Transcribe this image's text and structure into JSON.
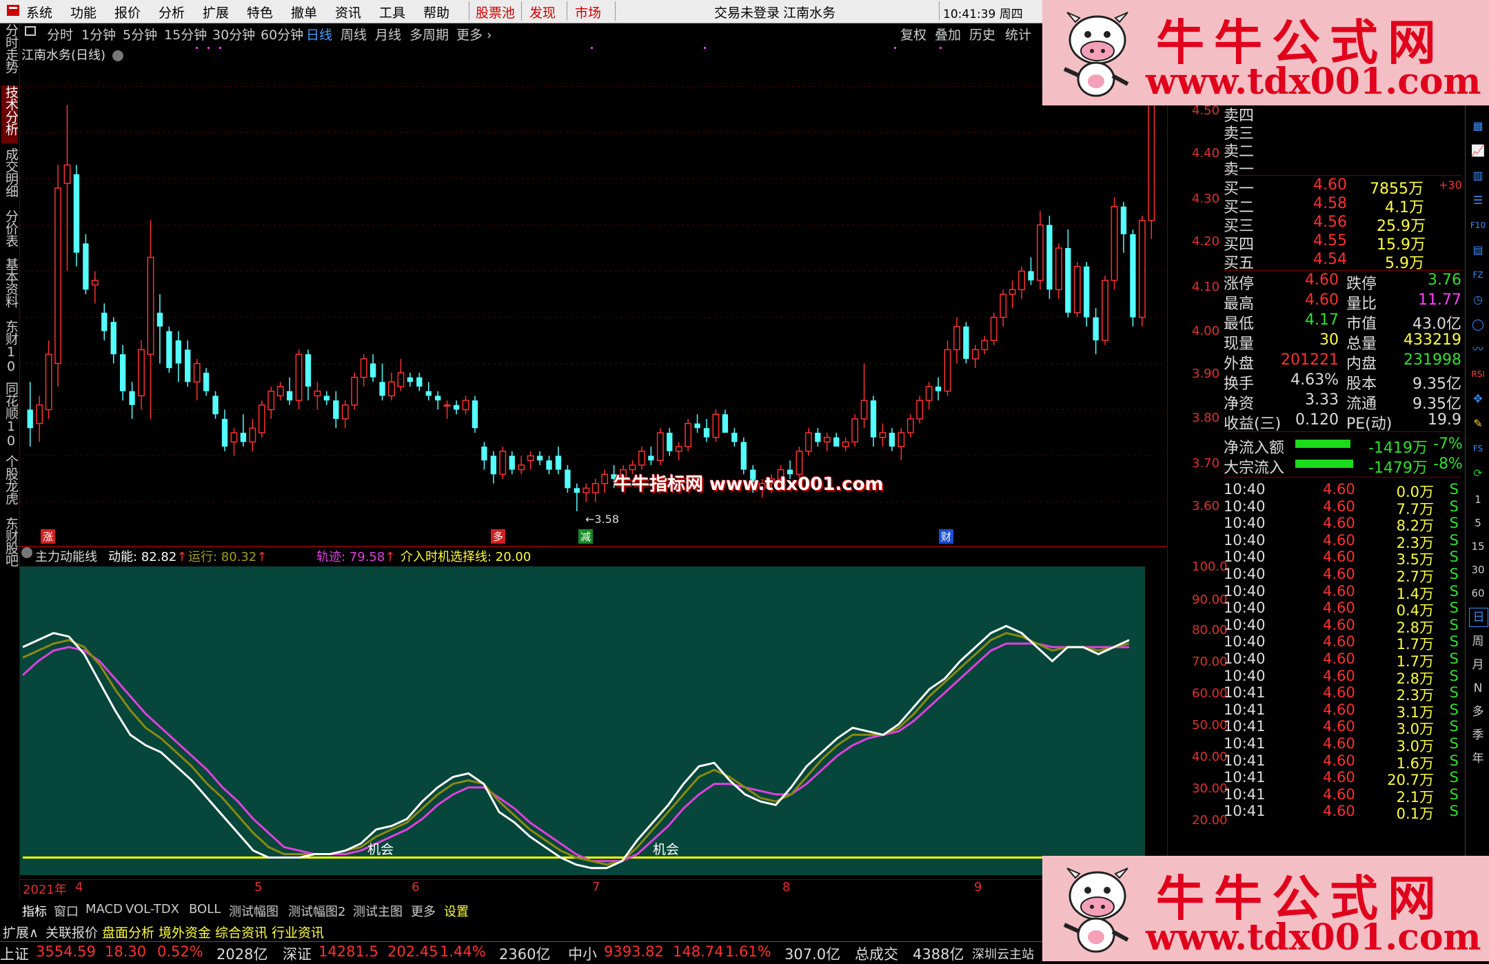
{
  "menu": {
    "items": [
      "系统",
      "功能",
      "报价",
      "分析",
      "扩展",
      "特色",
      "撤单",
      "资讯",
      "工具",
      "帮助"
    ],
    "red_items": [
      "股票池",
      "发现",
      "市场"
    ],
    "login_status": "交易未登录",
    "stock_title": "江南水务",
    "clock": "10:41:39 周四"
  },
  "periods": {
    "items": [
      "分时",
      "1分钟",
      "5分钟",
      "15分钟",
      "30分钟",
      "60分钟",
      "日线",
      "周线",
      "月线",
      "多周期",
      "更多"
    ],
    "active": "日线",
    "tools": [
      "复权",
      "叠加",
      "历史",
      "统计"
    ]
  },
  "left_tabs": [
    "分时走势",
    "技术分析",
    "成交明细",
    "分价表",
    "基本资料",
    "东财10",
    "同花顺10",
    "个股龙虎",
    "东财股吧"
  ],
  "left_tab_active": "技术分析",
  "main_chart": {
    "title": "江南水务(日线)",
    "low_marker": "3.58",
    "badges": [
      {
        "label": "涨",
        "color": "#d02020"
      },
      {
        "label": "多",
        "color": "#d02020"
      },
      {
        "label": "减",
        "color": "#1a8a2a"
      },
      {
        "label": "财",
        "color": "#1a4fd0"
      }
    ],
    "y_labels": [
      "4.50",
      "4.40",
      "4.30",
      "4.20",
      "4.10",
      "4.00",
      "3.90",
      "3.80",
      "3.70",
      "3.60"
    ]
  },
  "indicator": {
    "name": "主力动能线",
    "dongneng_label": "动能: 82.82",
    "yunxing_label": "运行: 80.32",
    "guiji_label": "轨迹: 79.58",
    "entry_label": "介入时机选择线: 20.00",
    "opportunity_label": "机会",
    "y_labels": [
      "100.0",
      "90.00",
      "80.00",
      "70.00",
      "60.00",
      "50.00",
      "40.00",
      "30.00",
      "20.00"
    ],
    "colors": {
      "dongneng": "#ffffff",
      "yunxing": "#8a8a10",
      "guiji": "#e040e0",
      "entry": "#ffff00",
      "background": "#07463a"
    }
  },
  "time_axis": [
    "2021年",
    "4",
    "5",
    "6",
    "7",
    "8",
    "9"
  ],
  "order_book": {
    "sell": [
      "卖四",
      "卖三",
      "卖二",
      "卖一"
    ],
    "buy": [
      {
        "label": "买一",
        "price": "4.60",
        "vol": "7855万",
        "extra": "+30"
      },
      {
        "label": "买二",
        "price": "4.58",
        "vol": "4.1万",
        "extra": ""
      },
      {
        "label": "买三",
        "price": "4.56",
        "vol": "25.9万",
        "extra": ""
      },
      {
        "label": "买四",
        "price": "4.55",
        "vol": "15.9万",
        "extra": ""
      },
      {
        "label": "买五",
        "price": "4.54",
        "vol": "5.9万",
        "extra": ""
      }
    ]
  },
  "quote": [
    {
      "l1": "涨停",
      "v1": "4.60",
      "c1": "#ff3030",
      "l2": "跌停",
      "v2": "3.76",
      "c2": "#30e030"
    },
    {
      "l1": "最高",
      "v1": "4.60",
      "c1": "#ff3030",
      "l2": "量比",
      "v2": "11.77",
      "c2": "#ff40ff"
    },
    {
      "l1": "最低",
      "v1": "4.17",
      "c1": "#30e030",
      "l2": "市值",
      "v2": "43.0亿",
      "c2": "#dddddd"
    },
    {
      "l1": "现量",
      "v1": "30",
      "c1": "#ffff40",
      "l2": "总量",
      "v2": "433219",
      "c2": "#ffff40"
    },
    {
      "l1": "外盘",
      "v1": "201221",
      "c1": "#ff3030",
      "l2": "内盘",
      "v2": "231998",
      "c2": "#30e030"
    },
    {
      "l1": "换手",
      "v1": "4.63%",
      "c1": "#dddddd",
      "l2": "股本",
      "v2": "9.35亿",
      "c2": "#dddddd"
    },
    {
      "l1": "净资",
      "v1": "3.33",
      "c1": "#dddddd",
      "l2": "流通",
      "v2": "9.35亿",
      "c2": "#dddddd"
    },
    {
      "l1": "收益(三)",
      "v1": "0.120",
      "c1": "#dddddd",
      "l2": "PE(动)",
      "v2": "19.9",
      "c2": "#dddddd"
    }
  ],
  "flows": [
    {
      "label": "净流入额",
      "value": "-1419万",
      "pct": "-7%"
    },
    {
      "label": "大宗流入",
      "value": "-1479万",
      "pct": "-8%"
    }
  ],
  "ticks": [
    {
      "t": "10:40",
      "p": "4.60",
      "v": "0.0万",
      "s": "S"
    },
    {
      "t": "10:40",
      "p": "4.60",
      "v": "7.7万",
      "s": "S"
    },
    {
      "t": "10:40",
      "p": "4.60",
      "v": "8.2万",
      "s": "S"
    },
    {
      "t": "10:40",
      "p": "4.60",
      "v": "2.3万",
      "s": "S"
    },
    {
      "t": "10:40",
      "p": "4.60",
      "v": "3.5万",
      "s": "S"
    },
    {
      "t": "10:40",
      "p": "4.60",
      "v": "2.7万",
      "s": "S"
    },
    {
      "t": "10:40",
      "p": "4.60",
      "v": "1.4万",
      "s": "S"
    },
    {
      "t": "10:40",
      "p": "4.60",
      "v": "0.4万",
      "s": "S"
    },
    {
      "t": "10:40",
      "p": "4.60",
      "v": "2.8万",
      "s": "S"
    },
    {
      "t": "10:40",
      "p": "4.60",
      "v": "1.7万",
      "s": "S"
    },
    {
      "t": "10:40",
      "p": "4.60",
      "v": "1.7万",
      "s": "S"
    },
    {
      "t": "10:40",
      "p": "4.60",
      "v": "2.8万",
      "s": "S"
    },
    {
      "t": "10:41",
      "p": "4.60",
      "v": "2.3万",
      "s": "S"
    },
    {
      "t": "10:41",
      "p": "4.60",
      "v": "3.1万",
      "s": "S"
    },
    {
      "t": "10:41",
      "p": "4.60",
      "v": "3.0万",
      "s": "S"
    },
    {
      "t": "10:41",
      "p": "4.60",
      "v": "3.0万",
      "s": "S"
    },
    {
      "t": "10:41",
      "p": "4.60",
      "v": "1.6万",
      "s": "S"
    },
    {
      "t": "10:41",
      "p": "4.60",
      "v": "20.7万",
      "s": "S"
    },
    {
      "t": "10:41",
      "p": "4.60",
      "v": "2.1万",
      "s": "S"
    },
    {
      "t": "10:41",
      "p": "4.60",
      "v": "0.1万",
      "s": "S"
    }
  ],
  "right_icons": [
    "1",
    "5",
    "15",
    "30",
    "60",
    "日",
    "周",
    "月",
    "N",
    "多",
    "季",
    "年"
  ],
  "indicator_tabs": [
    "指标",
    "窗口",
    "MACD",
    "VOL-TDX",
    "BOLL",
    "测试幅图",
    "测试幅图2",
    "测试主图",
    "更多",
    "设置"
  ],
  "function_tabs": [
    {
      "label": "扩展∧",
      "color": "#dddddd"
    },
    {
      "label": "关联报价",
      "color": "#dddddd"
    },
    {
      "label": "盘面分析",
      "color": "#ffff40"
    },
    {
      "label": "境外资金",
      "color": "#ffff40"
    },
    {
      "label": "综合资讯",
      "color": "#ffff40"
    },
    {
      "label": "行业资讯",
      "color": "#ffff40"
    }
  ],
  "status": [
    {
      "label": "上证",
      "v": "3554.59",
      "c": "18.30",
      "p": "0.52%",
      "amt": "2028亿"
    },
    {
      "label": "深证",
      "v": "14281.5",
      "c": "202.45",
      "p": "1.44%",
      "amt": "2360亿"
    },
    {
      "label": "中小",
      "v": "9393.82",
      "c": "148.74",
      "p": "1.61%",
      "amt": "307.0亿"
    }
  ],
  "status_total_label": "总成交",
  "status_total": "4388亿",
  "status_site": "深圳云主站",
  "ads": {
    "cn": "牛牛公式网",
    "url": "www.tdx001.com"
  },
  "watermark": "牛牛指标网 www.tdx001.com",
  "chart_data": {
    "type": "candlestick",
    "title": "江南水务(日线)",
    "ylim": [
      3.55,
      4.55
    ],
    "candles_ohlc": [
      [
        3.8,
        3.86,
        3.72,
        3.76
      ],
      [
        3.77,
        3.83,
        3.73,
        3.81
      ],
      [
        3.8,
        3.95,
        3.78,
        3.92
      ],
      [
        3.9,
        4.33,
        3.85,
        4.28
      ],
      [
        4.29,
        4.46,
        4.1,
        4.33
      ],
      [
        4.31,
        4.33,
        4.11,
        4.14
      ],
      [
        4.16,
        4.18,
        4.05,
        4.06
      ],
      [
        4.07,
        4.1,
        4.03,
        4.08
      ],
      [
        4.01,
        4.03,
        3.95,
        3.97
      ],
      [
        3.99,
        4.0,
        3.9,
        3.92
      ],
      [
        3.92,
        3.94,
        3.82,
        3.84
      ],
      [
        3.84,
        3.86,
        3.78,
        3.81
      ],
      [
        3.83,
        3.95,
        3.8,
        3.93
      ],
      [
        3.92,
        4.21,
        3.78,
        4.13
      ],
      [
        4.01,
        4.05,
        3.9,
        3.98
      ],
      [
        3.97,
        3.98,
        3.88,
        3.89
      ],
      [
        3.95,
        3.97,
        3.86,
        3.9
      ],
      [
        3.93,
        3.95,
        3.85,
        3.86
      ],
      [
        3.86,
        3.91,
        3.82,
        3.9
      ],
      [
        3.88,
        3.89,
        3.83,
        3.84
      ],
      [
        3.83,
        3.84,
        3.78,
        3.79
      ],
      [
        3.78,
        3.8,
        3.71,
        3.72
      ],
      [
        3.73,
        3.76,
        3.7,
        3.75
      ],
      [
        3.75,
        3.79,
        3.72,
        3.73
      ],
      [
        3.73,
        3.78,
        3.71,
        3.76
      ],
      [
        3.75,
        3.82,
        3.74,
        3.81
      ],
      [
        3.8,
        3.85,
        3.78,
        3.84
      ],
      [
        3.83,
        3.86,
        3.82,
        3.85
      ],
      [
        3.84,
        3.87,
        3.81,
        3.82
      ],
      [
        3.82,
        3.93,
        3.8,
        3.92
      ],
      [
        3.92,
        3.93,
        3.82,
        3.85
      ],
      [
        3.83,
        3.86,
        3.8,
        3.84
      ],
      [
        3.83,
        3.84,
        3.81,
        3.82
      ],
      [
        3.82,
        3.84,
        3.76,
        3.78
      ],
      [
        3.78,
        3.82,
        3.76,
        3.81
      ],
      [
        3.81,
        3.88,
        3.8,
        3.87
      ],
      [
        3.87,
        3.92,
        3.85,
        3.91
      ],
      [
        3.9,
        3.92,
        3.86,
        3.87
      ],
      [
        3.86,
        3.9,
        3.82,
        3.83
      ],
      [
        3.83,
        3.88,
        3.82,
        3.86
      ],
      [
        3.85,
        3.91,
        3.84,
        3.88
      ],
      [
        3.87,
        3.88,
        3.85,
        3.86
      ],
      [
        3.87,
        3.88,
        3.84,
        3.85
      ],
      [
        3.84,
        3.86,
        3.82,
        3.83
      ],
      [
        3.83,
        3.84,
        3.8,
        3.82
      ],
      [
        3.81,
        3.82,
        3.78,
        3.81
      ],
      [
        3.81,
        3.82,
        3.79,
        3.8
      ],
      [
        3.8,
        3.83,
        3.79,
        3.82
      ],
      [
        3.82,
        3.83,
        3.75,
        3.76
      ],
      [
        3.72,
        3.73,
        3.67,
        3.69
      ],
      [
        3.7,
        3.71,
        3.64,
        3.66
      ],
      [
        3.66,
        3.72,
        3.65,
        3.71
      ],
      [
        3.7,
        3.71,
        3.66,
        3.67
      ],
      [
        3.67,
        3.7,
        3.66,
        3.68
      ],
      [
        3.69,
        3.71,
        3.67,
        3.7
      ],
      [
        3.7,
        3.71,
        3.68,
        3.69
      ],
      [
        3.69,
        3.7,
        3.66,
        3.67
      ],
      [
        3.7,
        3.72,
        3.66,
        3.67
      ],
      [
        3.67,
        3.68,
        3.62,
        3.63
      ],
      [
        3.63,
        3.64,
        3.58,
        3.62
      ],
      [
        3.62,
        3.64,
        3.6,
        3.63
      ],
      [
        3.62,
        3.65,
        3.6,
        3.64
      ],
      [
        3.64,
        3.67,
        3.62,
        3.66
      ],
      [
        3.66,
        3.68,
        3.63,
        3.65
      ],
      [
        3.65,
        3.68,
        3.64,
        3.67
      ],
      [
        3.67,
        3.69,
        3.66,
        3.68
      ],
      [
        3.68,
        3.72,
        3.67,
        3.71
      ],
      [
        3.7,
        3.72,
        3.68,
        3.69
      ],
      [
        3.69,
        3.76,
        3.68,
        3.75
      ],
      [
        3.75,
        3.76,
        3.7,
        3.71
      ],
      [
        3.71,
        3.73,
        3.69,
        3.72
      ],
      [
        3.72,
        3.78,
        3.71,
        3.77
      ],
      [
        3.77,
        3.79,
        3.75,
        3.76
      ],
      [
        3.76,
        3.78,
        3.73,
        3.74
      ],
      [
        3.74,
        3.8,
        3.73,
        3.79
      ],
      [
        3.79,
        3.8,
        3.75,
        3.75
      ],
      [
        3.75,
        3.76,
        3.72,
        3.73
      ],
      [
        3.73,
        3.74,
        3.66,
        3.67
      ],
      [
        3.67,
        3.68,
        3.62,
        3.63
      ],
      [
        3.63,
        3.65,
        3.61,
        3.64
      ],
      [
        3.64,
        3.66,
        3.62,
        3.65
      ],
      [
        3.65,
        3.68,
        3.63,
        3.67
      ],
      [
        3.67,
        3.69,
        3.65,
        3.66
      ],
      [
        3.66,
        3.72,
        3.65,
        3.71
      ],
      [
        3.71,
        3.76,
        3.7,
        3.75
      ],
      [
        3.75,
        3.76,
        3.72,
        3.73
      ],
      [
        3.73,
        3.75,
        3.71,
        3.74
      ],
      [
        3.74,
        3.75,
        3.72,
        3.72
      ],
      [
        3.72,
        3.74,
        3.71,
        3.73
      ],
      [
        3.73,
        3.79,
        3.72,
        3.78
      ],
      [
        3.78,
        3.9,
        3.76,
        3.82
      ],
      [
        3.82,
        3.83,
        3.72,
        3.74
      ],
      [
        3.74,
        3.77,
        3.72,
        3.75
      ],
      [
        3.75,
        3.76,
        3.71,
        3.72
      ],
      [
        3.72,
        3.76,
        3.69,
        3.75
      ],
      [
        3.75,
        3.79,
        3.74,
        3.78
      ],
      [
        3.78,
        3.83,
        3.77,
        3.82
      ],
      [
        3.82,
        3.86,
        3.8,
        3.85
      ],
      [
        3.85,
        3.87,
        3.82,
        3.84
      ],
      [
        3.84,
        3.95,
        3.83,
        3.93
      ],
      [
        3.93,
        4.0,
        3.9,
        3.98
      ],
      [
        3.98,
        3.99,
        3.9,
        3.91
      ],
      [
        3.91,
        3.94,
        3.89,
        3.93
      ],
      [
        3.93,
        3.96,
        3.92,
        3.95
      ],
      [
        3.95,
        4.01,
        3.94,
        4.0
      ],
      [
        4.0,
        4.06,
        3.98,
        4.05
      ],
      [
        4.05,
        4.08,
        4.02,
        4.06
      ],
      [
        4.06,
        4.11,
        4.04,
        4.1
      ],
      [
        4.1,
        4.13,
        4.07,
        4.08
      ],
      [
        4.08,
        4.23,
        4.06,
        4.2
      ],
      [
        4.2,
        4.22,
        4.04,
        4.06
      ],
      [
        4.06,
        4.16,
        4.04,
        4.15
      ],
      [
        4.15,
        4.19,
        4.0,
        4.01
      ],
      [
        4.01,
        4.12,
        4.0,
        4.11
      ],
      [
        4.11,
        4.12,
        3.98,
        4.0
      ],
      [
        4.0,
        4.02,
        3.92,
        3.95
      ],
      [
        3.95,
        4.09,
        3.94,
        4.08
      ],
      [
        4.08,
        4.26,
        4.06,
        4.24
      ],
      [
        4.24,
        4.25,
        4.14,
        4.18
      ],
      [
        4.18,
        4.19,
        3.98,
        4.0
      ],
      [
        4.0,
        4.22,
        3.98,
        4.21
      ],
      [
        4.21,
        4.6,
        4.17,
        4.6
      ]
    ],
    "indicator_series": {
      "dongneng": [
        80,
        82,
        84,
        83,
        78,
        70,
        62,
        55,
        52,
        50,
        46,
        42,
        37,
        32,
        27,
        22,
        20,
        20,
        20,
        21,
        21,
        22,
        24,
        28,
        29,
        31,
        36,
        40,
        43,
        44,
        41,
        33,
        30,
        26,
        23,
        20,
        18,
        17,
        17,
        19,
        25,
        30,
        35,
        41,
        46,
        47,
        42,
        38,
        36,
        35,
        40,
        46,
        50,
        54,
        57,
        56,
        55,
        58,
        63,
        68,
        71,
        76,
        80,
        84,
        86,
        84,
        80,
        76,
        80,
        80,
        78,
        80,
        82
      ],
      "yunxing": [
        77,
        79,
        81,
        82,
        80,
        75,
        68,
        62,
        57,
        54,
        50,
        46,
        41,
        37,
        32,
        27,
        23,
        21,
        21,
        21,
        21,
        22,
        23,
        26,
        28,
        30,
        34,
        38,
        41,
        42,
        41,
        36,
        32,
        28,
        25,
        22,
        20,
        19,
        18,
        19,
        23,
        28,
        33,
        38,
        43,
        45,
        43,
        40,
        37,
        36,
        38,
        43,
        48,
        52,
        55,
        55,
        55,
        57,
        61,
        66,
        70,
        74,
        78,
        82,
        84,
        83,
        81,
        79,
        80,
        80,
        79,
        80,
        81
      ],
      "guiji": [
        72,
        76,
        79,
        80,
        79,
        76,
        71,
        66,
        61,
        57,
        53,
        49,
        45,
        40,
        36,
        31,
        27,
        23,
        22,
        21,
        21,
        21,
        22,
        24,
        26,
        28,
        31,
        35,
        38,
        40,
        40,
        37,
        34,
        30,
        27,
        24,
        21,
        19,
        19,
        19,
        21,
        25,
        29,
        34,
        38,
        41,
        41,
        40,
        39,
        38,
        38,
        41,
        45,
        49,
        52,
        54,
        55,
        56,
        59,
        63,
        67,
        71,
        75,
        79,
        81,
        81,
        81,
        80,
        80,
        80,
        80,
        80,
        80
      ],
      "entry": 20
    },
    "indicator_ylim": [
      15,
      103
    ]
  }
}
